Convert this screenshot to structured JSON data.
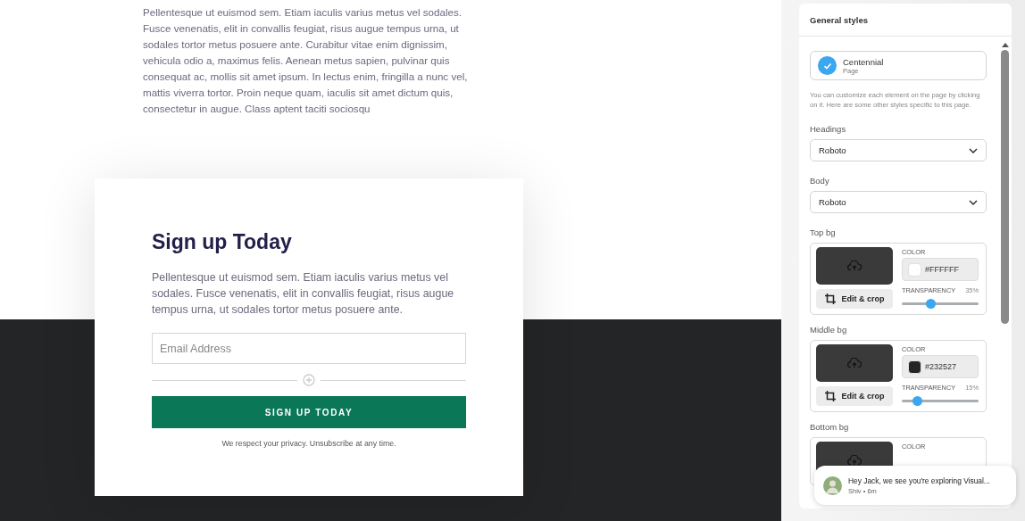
{
  "page": {
    "intro": "Pellentesque ut euismod sem. Etiam iaculis varius metus vel sodales. Fusce venenatis, elit in convallis feugiat, risus augue tempus urna, ut sodales tortor metus posuere ante. Curabitur vitae enim dignissim, vehicula odio a, maximus felis. Aenean metus sapien, pulvinar quis consequat ac, mollis sit amet ipsum. In lectus enim, fringilla a nunc vel, mattis viverra tortor. Proin neque quam, iaculis sit amet dictum quis, consectetur in augue. Class aptent taciti sociosqu"
  },
  "signup": {
    "title": "Sign up Today",
    "text": "Pellentesque ut euismod sem. Etiam iaculis varius metus vel sodales. Fusce venenatis, elit in convallis feugiat, risus augue tempus urna, ut sodales tortor metus posuere ante.",
    "email": {
      "placeholder": "Email Address"
    },
    "button": "SIGN UP TODAY",
    "privacy": "We respect your privacy. Unsubscribe at any time."
  },
  "panel": {
    "title": "General styles",
    "page": {
      "name": "Centennial",
      "type": "Page",
      "checked": true
    },
    "description": "You can customize each element on the page by clicking on it. Here are some other styles specific to this page.",
    "fonts": [
      {
        "label": "Headings",
        "value": "Roboto"
      },
      {
        "label": "Body",
        "value": "Roboto"
      }
    ],
    "backgrounds": [
      {
        "label": "Top bg",
        "edit": "Edit & crop",
        "color_label": "COLOR",
        "color": "#ffffff",
        "hex": "#FFFFFF",
        "transparency_label": "TRANSPARENCY",
        "transparency": "35%",
        "level": 0.37
      },
      {
        "label": "Middle bg",
        "edit": "Edit & crop",
        "color_label": "COLOR",
        "color": "#232527",
        "hex": "#232527",
        "transparency_label": "TRANSPARENCY",
        "transparency": "15%",
        "level": 0.2
      },
      {
        "label": "Bottom bg",
        "color_label": "COLOR"
      }
    ]
  },
  "chat": {
    "message": "Hey Jack, we see you're exploring Visual...",
    "meta": "Shiv • 6m"
  }
}
